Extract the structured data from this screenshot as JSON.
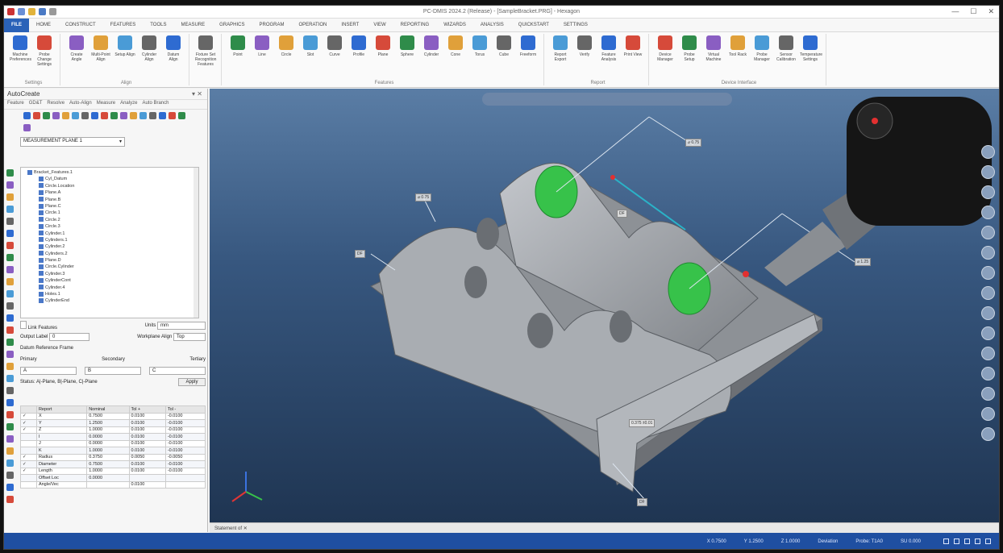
{
  "window": {
    "title": "PC-DMIS 2024.2 (Release) - [SampleBracket.PRG] - Hexagon"
  },
  "tabs": [
    "File",
    "Home",
    "Construct",
    "Features",
    "Tools",
    "Measure",
    "Graphics",
    "Program",
    "Operation",
    "Insert",
    "View",
    "Reporting",
    "Wizards",
    "Analysis",
    "QuickStart",
    "Settings"
  ],
  "ribbon_groups": [
    {
      "label": "Settings",
      "buttons": [
        "Machine Preferences",
        "Probe Change Settings"
      ]
    },
    {
      "label": "Align",
      "buttons": [
        "Create Angle",
        "Multi-Point Align",
        "Setup Align",
        "Cylinder Align",
        "Datum Align"
      ]
    },
    {
      "label": "",
      "buttons": [
        "Fixture Set Recognition Features"
      ]
    },
    {
      "label": "Features",
      "buttons": [
        "Point",
        "Line",
        "Circle",
        "Slot",
        "Curve",
        "Profile",
        "Plane",
        "Sphere",
        "Cylinder",
        "Cone",
        "Torus",
        "Cube",
        "Freeform"
      ]
    },
    {
      "label": "Report",
      "buttons": [
        "Report Export",
        "Verify",
        "Feature Analysis",
        "Print View"
      ]
    },
    {
      "label": "Device Interface",
      "buttons": [
        "Device Manager",
        "Probe Setup",
        "Virtual Machine",
        "Tool Rack",
        "Probe Manager",
        "Sensor Calibration",
        "Temperature Settings"
      ]
    }
  ],
  "left_panel": {
    "title": "AutoCreate",
    "tabs": [
      "Feature",
      "GD&T",
      "Resolve",
      "Auto-Align",
      "Measure",
      "Analyze",
      "Auto Branch"
    ],
    "plane_select": "MEASUREMENT PLANE 1",
    "tree": [
      "Bracket_Features.1",
      "Cyl_Datum",
      "Circle.Location",
      "Plane.A",
      "Plane.B",
      "Plane.C",
      "Circle.1",
      "Circle.2",
      "Circle.3",
      "Cylinder.1",
      "Cylinders.1",
      "Cylinder.2",
      "Cylinders.2",
      "Plane.D",
      "Circle.Cylinder",
      "Cylinder.3",
      "CylinderCont",
      "Cylinder.4",
      "Holes.1",
      "CylinderEnd"
    ],
    "props": {
      "chk_label": "Link Features",
      "units_label": "Units",
      "units_value": "mm",
      "output_label": "Output Label",
      "output_value": "0",
      "workplane_label": "Workplane Align",
      "workplane_value": "Top",
      "ref_label": "Datum Reference Frame",
      "primary": "Primary",
      "secondary": "Secondary",
      "tertiary": "Tertiary",
      "p_val": "A",
      "s_val": "B",
      "t_val": "C",
      "status_label": "Status",
      "status_value": "A|-Plane, B|-Plane, C|-Plane",
      "apply": "Apply"
    },
    "grid": {
      "headers": [
        "",
        "Report",
        "Nominal",
        "Tol +",
        "Tol -"
      ],
      "rows": [
        [
          "✓",
          "X",
          "0.7500",
          "0.0100",
          "-0.0100"
        ],
        [
          "✓",
          "Y",
          "1.2500",
          "0.0100",
          "-0.0100"
        ],
        [
          "✓",
          "Z",
          "1.0000",
          "0.0100",
          "-0.0100"
        ],
        [
          "",
          "I",
          "0.0000",
          "0.0100",
          "-0.0100"
        ],
        [
          "",
          "J",
          "0.0000",
          "0.0100",
          "-0.0100"
        ],
        [
          "",
          "K",
          "1.0000",
          "0.0100",
          "-0.0100"
        ],
        [
          "✓",
          "Radius",
          "0.3750",
          "0.0050",
          "-0.0050"
        ],
        [
          "✓",
          "Diameter",
          "0.7500",
          "0.0100",
          "-0.0100"
        ],
        [
          "✓",
          "Length",
          "1.0000",
          "0.0100",
          "-0.0100"
        ],
        [
          "",
          "Offset Loc",
          "0.0000",
          "",
          ""
        ],
        [
          "",
          "Angle/Vec",
          "",
          "0.0100",
          ""
        ]
      ]
    }
  },
  "viewport": {
    "callouts": [
      "⌀ 0.75",
      "⌀ 1.25",
      "⌀ 0.75",
      "DF",
      "DF",
      "0.375 ±0.01",
      "DF"
    ]
  },
  "doc_tab": "Statement of",
  "status": [
    "X 0.7500",
    "Y 1.2500",
    "Z 1.0000",
    "Deviation",
    "Probe: T1A0",
    "SU 0.000"
  ],
  "colors": {
    "accent": "#2a62b8",
    "status": "#1f4fa1",
    "part": "#9da1a6",
    "highlight": "#37c24a"
  }
}
